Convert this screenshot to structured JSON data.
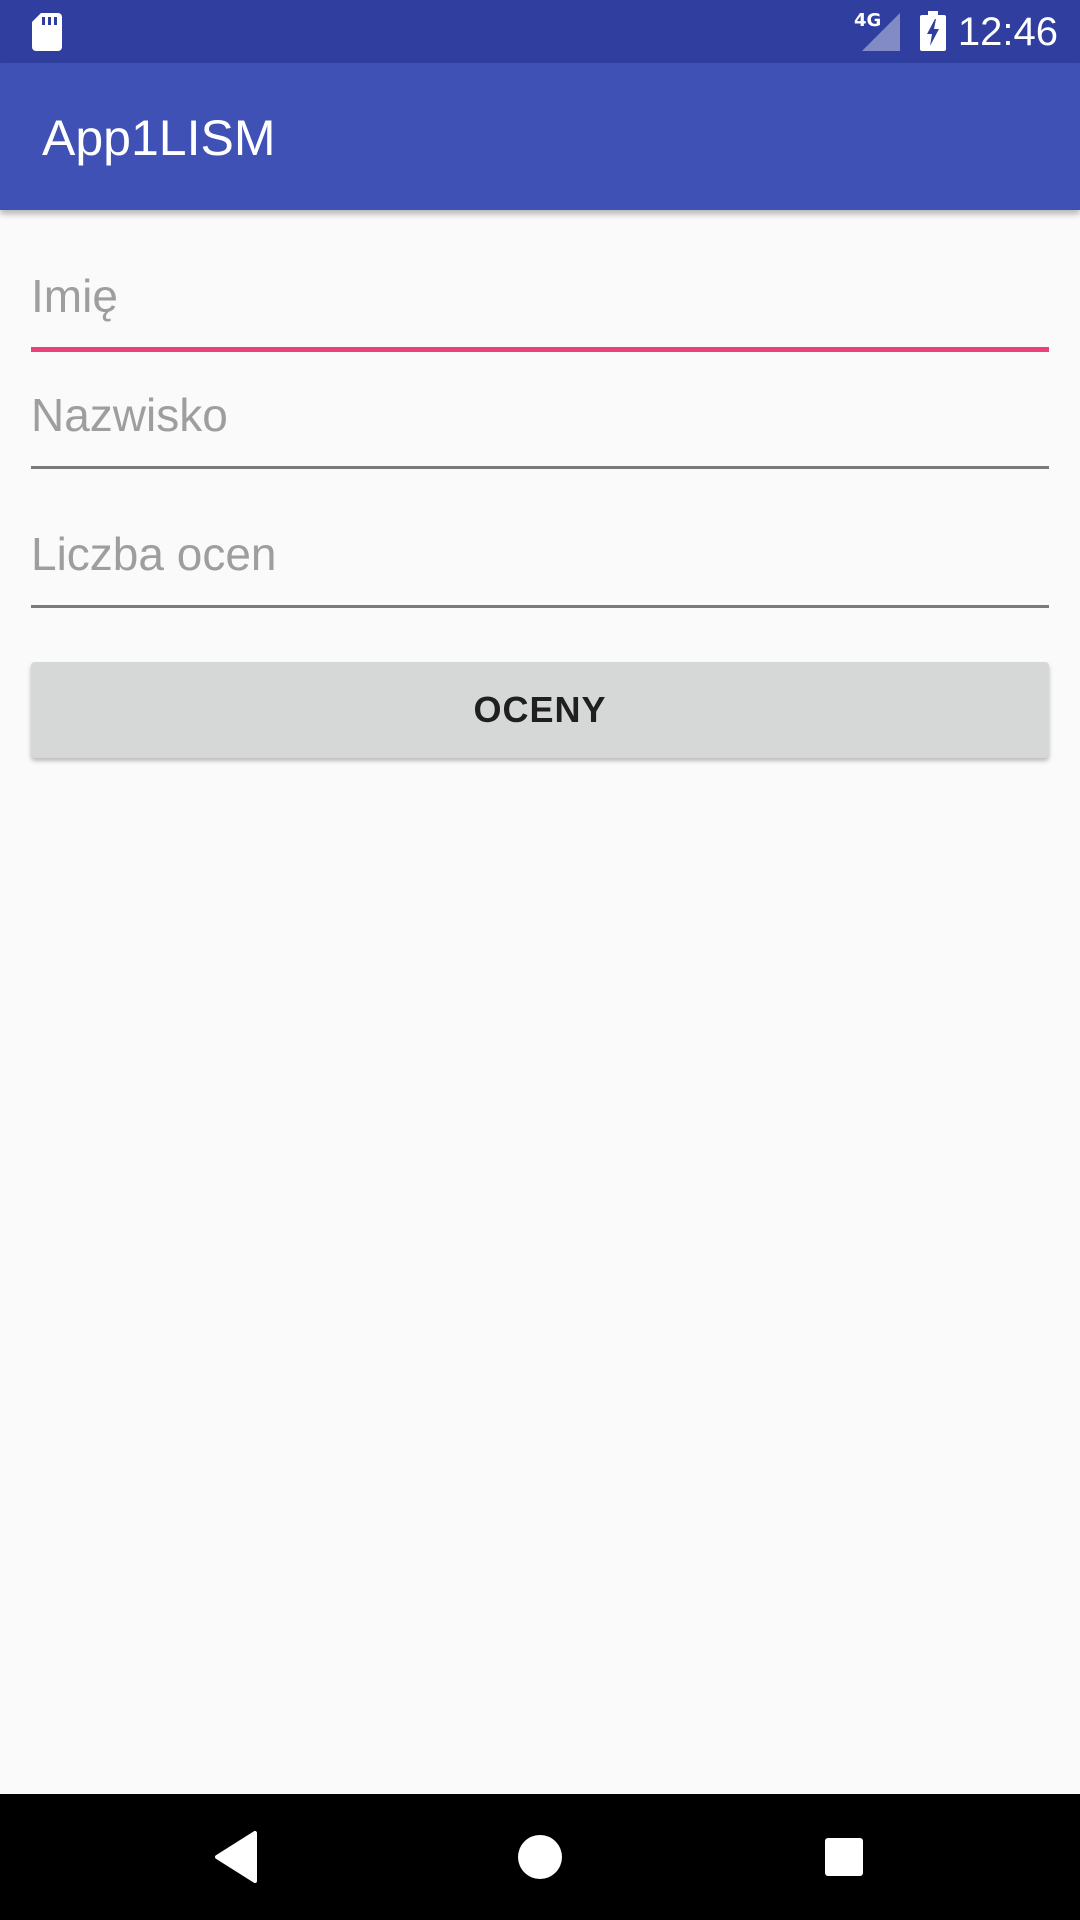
{
  "status_bar": {
    "network_type": "4G",
    "time": "12:46",
    "icons": [
      "sd-card-icon",
      "signal-icon",
      "battery-charging-icon"
    ]
  },
  "app_bar": {
    "title": "App1LISM"
  },
  "form": {
    "first_name": {
      "placeholder": "Imię",
      "value": "",
      "focused": true
    },
    "last_name": {
      "placeholder": "Nazwisko",
      "value": ""
    },
    "grade_count": {
      "placeholder": "Liczba ocen",
      "value": ""
    }
  },
  "button": {
    "label": "OCENY"
  },
  "nav_bar": {
    "icons": [
      "back-icon",
      "home-icon",
      "recents-icon"
    ]
  },
  "colors": {
    "status_bar": "#303f9f",
    "app_bar": "#3f51b5",
    "accent": "#ec407a",
    "background": "#fafafa",
    "button": "#d6d7d7"
  }
}
